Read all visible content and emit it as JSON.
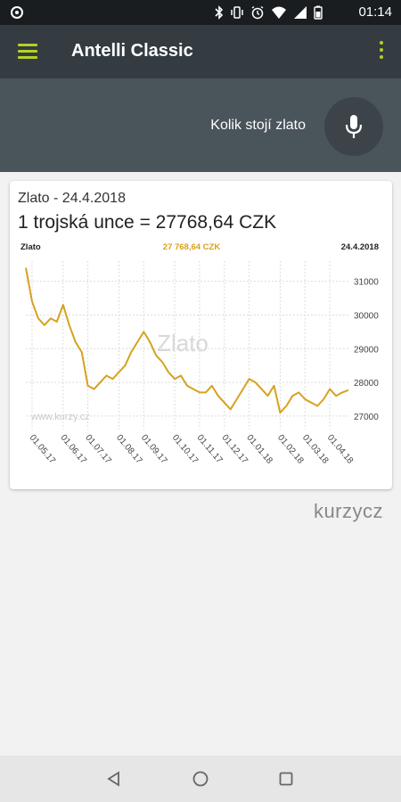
{
  "status": {
    "time": "01:14"
  },
  "appbar": {
    "title": "Antelli Classic"
  },
  "voice": {
    "query": "Kolik stojí zlato"
  },
  "card": {
    "date_line": "Zlato - 24.4.2018",
    "price_line": "1 trojská unce = 27768,64 CZK"
  },
  "chart_data": {
    "type": "line",
    "header_left": "Zlato",
    "header_center": "27 768,64 CZK",
    "header_right": "24.4.2018",
    "watermark": "Zlato",
    "source_label": "www.kurzy.cz",
    "line_color": "#d6a21e",
    "header_center_color": "#d6a21e",
    "ylim": [
      26600,
      31600
    ],
    "yticks": [
      "31000",
      "30000",
      "29000",
      "28000",
      "27000"
    ],
    "ytick_values": [
      31000,
      30000,
      29000,
      28000,
      27000
    ],
    "xticks": [
      "01.05.17",
      "01.06.17",
      "01.07.17",
      "01.08.17",
      "01.09.17",
      "01.10.17",
      "01.11.17",
      "01.12.17",
      "01.01.18",
      "01.02.18",
      "01.03.18",
      "01.04.18"
    ],
    "x": [
      "24.04.17",
      "01.05.17",
      "08.05.17",
      "15.05.17",
      "22.05.17",
      "29.05.17",
      "05.06.17",
      "12.06.17",
      "19.06.17",
      "26.06.17",
      "03.07.17",
      "10.07.17",
      "17.07.17",
      "24.07.17",
      "31.07.17",
      "07.08.17",
      "14.08.17",
      "21.08.17",
      "28.08.17",
      "04.09.17",
      "11.09.17",
      "18.09.17",
      "25.09.17",
      "02.10.17",
      "09.10.17",
      "16.10.17",
      "23.10.17",
      "30.10.17",
      "06.11.17",
      "13.11.17",
      "20.11.17",
      "27.11.17",
      "04.12.17",
      "11.12.17",
      "18.12.17",
      "25.12.17",
      "01.01.18",
      "08.01.18",
      "15.01.18",
      "22.01.18",
      "29.01.18",
      "05.02.18",
      "12.02.18",
      "19.02.18",
      "26.02.18",
      "05.03.18",
      "12.03.18",
      "19.03.18",
      "26.03.18",
      "02.04.18",
      "09.04.18",
      "16.04.18",
      "24.04.18"
    ],
    "values": [
      31400,
      30400,
      29900,
      29700,
      29900,
      29800,
      30300,
      29700,
      29200,
      28900,
      27900,
      27800,
      28000,
      28200,
      28100,
      28300,
      28500,
      28900,
      29200,
      29500,
      29200,
      28800,
      28600,
      28300,
      28100,
      28200,
      27900,
      27800,
      27700,
      27700,
      27900,
      27600,
      27400,
      27200,
      27500,
      27800,
      28100,
      28000,
      27800,
      27600,
      27900,
      27100,
      27300,
      27600,
      27700,
      27500,
      27400,
      27300,
      27500,
      27800,
      27600,
      27700,
      27770
    ]
  },
  "brand": {
    "text": "kurzycz"
  },
  "colors": {
    "accent": "#b5d125",
    "appbar": "#343c42",
    "voicebar": "#4a545b"
  }
}
